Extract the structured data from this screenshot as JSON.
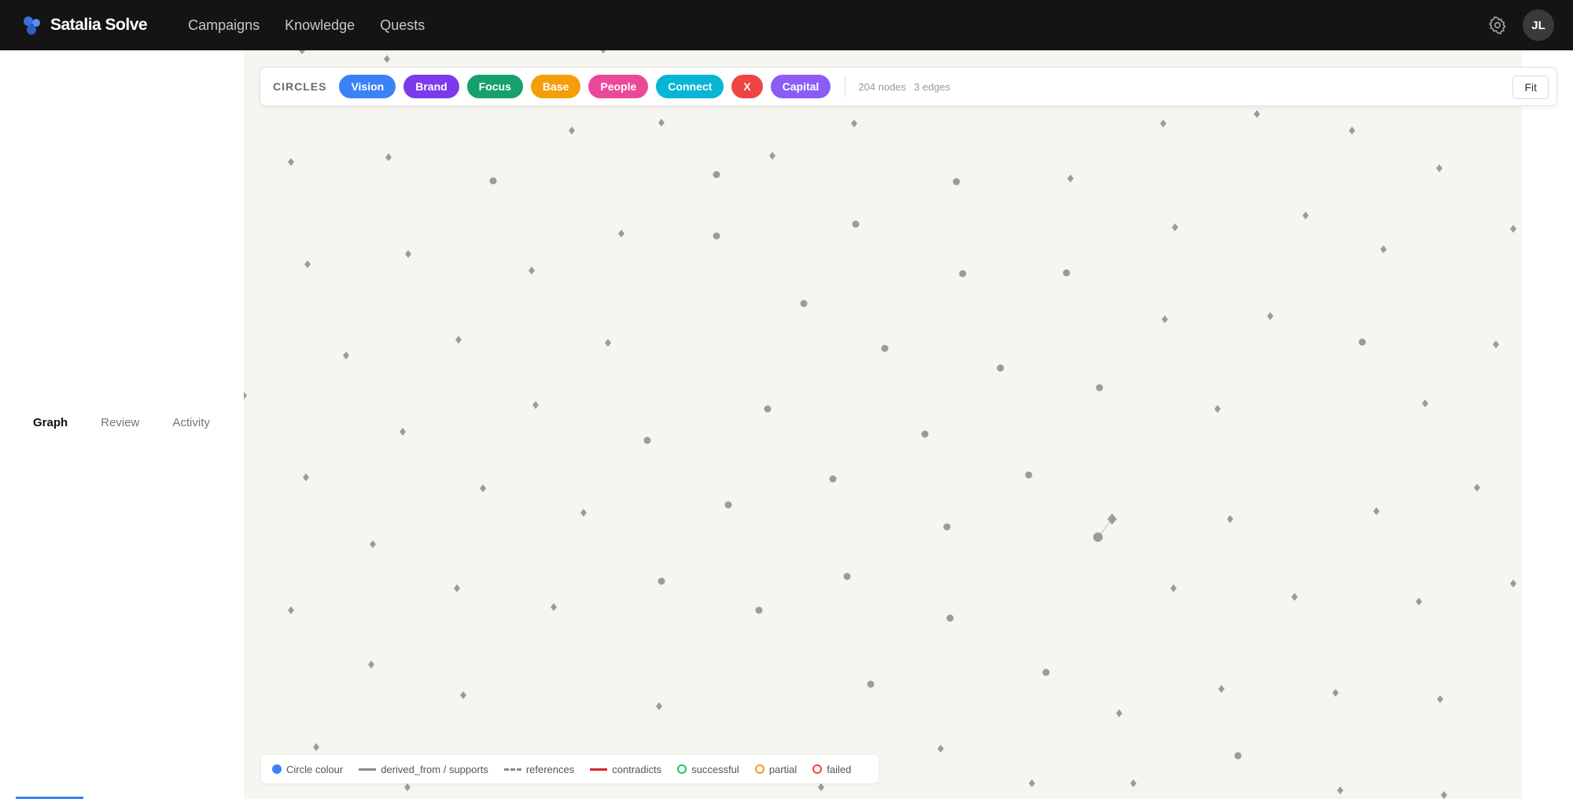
{
  "app": {
    "name": "Satalia Solve",
    "nav": [
      "Campaigns",
      "Knowledge",
      "Quests"
    ],
    "user_initials": "JL",
    "logo_color": "#3b6fd8"
  },
  "sidebar": {
    "tabs": [
      {
        "label": "Graph",
        "active": true
      },
      {
        "label": "Review",
        "active": false
      },
      {
        "label": "Activity",
        "active": false
      }
    ]
  },
  "circles_bar": {
    "label": "CIRCLES",
    "chips": [
      {
        "label": "Vision",
        "color": "#3b82f6"
      },
      {
        "label": "Brand",
        "color": "#7c3aed"
      },
      {
        "label": "Focus",
        "color": "#16a06b"
      },
      {
        "label": "Base",
        "color": "#f59e0b"
      },
      {
        "label": "People",
        "color": "#ec4899"
      },
      {
        "label": "Connect",
        "color": "#06b6d4"
      },
      {
        "label": "X",
        "color": "#ef4444"
      },
      {
        "label": "Capital",
        "color": "#8b5cf6"
      }
    ],
    "nodes_stat": "204 nodes",
    "edges_stat": "3 edges",
    "fit_label": "Fit"
  },
  "legend": [
    {
      "kind": "dot",
      "color": "#3b82f6",
      "label": "Circle colour"
    },
    {
      "kind": "line",
      "color": "#8a8a8a",
      "label": "derived_from / supports"
    },
    {
      "kind": "dash",
      "color": "#8a8a8a",
      "label": "references"
    },
    {
      "kind": "line",
      "color": "#dc2626",
      "label": "contradicts"
    },
    {
      "kind": "ring",
      "color": "#22c55e",
      "label": "successful"
    },
    {
      "kind": "ring",
      "color": "#f59e0b",
      "label": "partial"
    },
    {
      "kind": "ring",
      "color": "#ef4444",
      "label": "failed"
    }
  ]
}
